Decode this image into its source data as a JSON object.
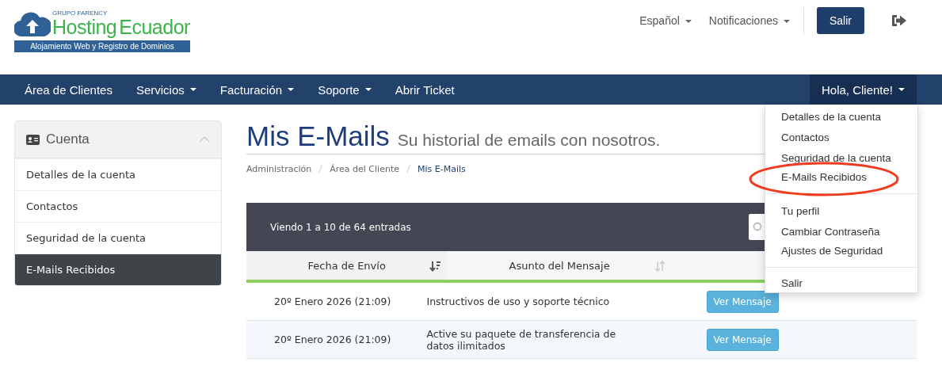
{
  "logo": {
    "group": "GRUPO FARENCY",
    "name_1": "Hosting",
    "name_2": "Ecuador",
    "tagline": "Alojamiento Web y Registro de Dominios"
  },
  "top_links": [
    {
      "label": "Español",
      "dropdown": true
    },
    {
      "label": "Notificaciones",
      "dropdown": true
    }
  ],
  "logout_button": "Salir",
  "nav": {
    "items": [
      {
        "label": "Área de Clientes",
        "dropdown": false
      },
      {
        "label": "Servicios",
        "dropdown": true
      },
      {
        "label": "Facturación",
        "dropdown": true
      },
      {
        "label": "Soporte",
        "dropdown": true
      },
      {
        "label": "Abrir Ticket",
        "dropdown": false
      }
    ],
    "user": {
      "label": "Hola, Cliente!",
      "expanded": true
    }
  },
  "user_menu": {
    "groups": [
      [
        {
          "label": "Detalles de la cuenta",
          "circled": false
        },
        {
          "label": "Contactos",
          "circled": false
        },
        {
          "label": "Seguridad de la cuenta",
          "circled": false
        },
        {
          "label": "E-Mails Recibidos",
          "circled": true
        }
      ],
      [
        {
          "label": "Tu perfil",
          "circled": false
        },
        {
          "label": "Cambiar Contraseña",
          "circled": false
        },
        {
          "label": "Ajustes de Seguridad",
          "circled": false
        }
      ],
      [
        {
          "label": "Salir",
          "circled": false
        }
      ]
    ]
  },
  "sidebar": {
    "title": "Cuenta",
    "items": [
      {
        "label": "Detalles de la cuenta",
        "selected": false
      },
      {
        "label": "Contactos",
        "selected": false
      },
      {
        "label": "Seguridad de la cuenta",
        "selected": false
      },
      {
        "label": "E-Mails Recibidos",
        "selected": true
      }
    ]
  },
  "page": {
    "title": "Mis E-Mails",
    "subtitle": "Su historial de emails con nosotros."
  },
  "breadcrumb": [
    {
      "label": "Administración",
      "current": false
    },
    {
      "label": "Área del Cliente",
      "current": false
    },
    {
      "label": "Mis E-Mails",
      "current": true
    }
  ],
  "table": {
    "info": "Viendo 1 a 10 de 64 entradas",
    "columns": [
      {
        "label": "Fecha de Envío",
        "sorted": true
      },
      {
        "label": "Asunto del Mensaje",
        "sorted": false
      }
    ],
    "rows": [
      {
        "date": "20º Enero 2026 (21:09)",
        "subject": "Instructivos de uso y soporte técnico",
        "action": "Ver Mensaje"
      },
      {
        "date": "20º Enero 2026 (21:09)",
        "subject": "Active su paquete de transferencia de datos ilimitados",
        "action": "Ver Mensaje"
      }
    ]
  }
}
